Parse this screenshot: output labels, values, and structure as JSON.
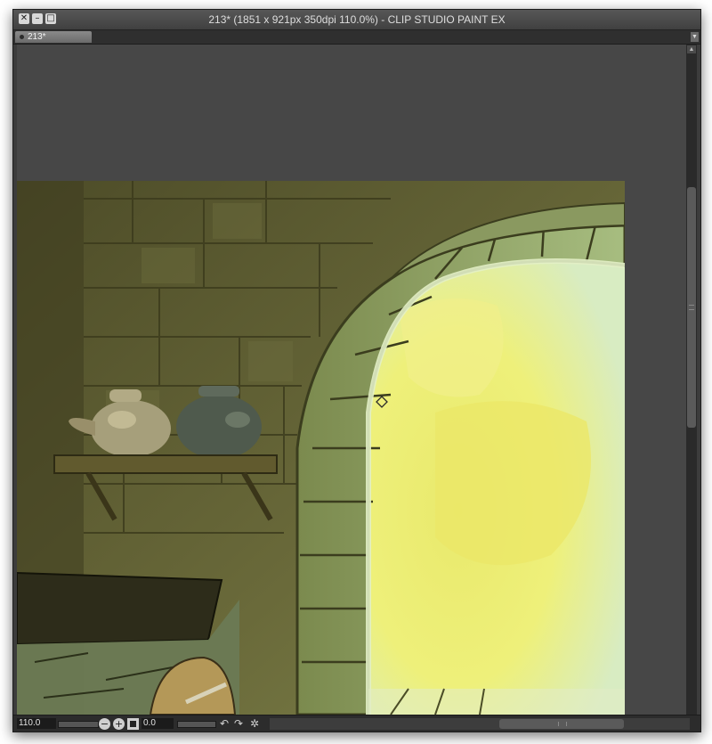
{
  "window": {
    "title": "213* (1851 x 921px 350dpi 110.0%)  - CLIP STUDIO PAINT EX",
    "buttons": {
      "close": "✕",
      "minimize": "–",
      "maximize": "□"
    }
  },
  "tabs": [
    {
      "label": "213*",
      "active": true
    }
  ],
  "statusbar": {
    "zoom": "110.0",
    "rotation": "0.0",
    "zoom_out_icon": "−",
    "zoom_in_icon": "+",
    "rotate_left_icon": "↶",
    "rotate_right_icon": "↷",
    "reset_icon": "✲"
  },
  "colors": {
    "workspace": "#474747",
    "window_chrome": "#3c3c3c",
    "window_light": "#eef07a"
  }
}
